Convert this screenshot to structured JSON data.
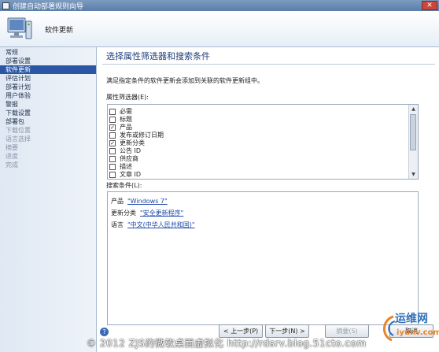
{
  "window": {
    "title": "创建自动部署规则向导",
    "close_glyph": "✕"
  },
  "header": {
    "title": "软件更新"
  },
  "sidebar": {
    "items": [
      {
        "label": "常规",
        "state": "normal"
      },
      {
        "label": "部署设置",
        "state": "normal"
      },
      {
        "label": "软件更新",
        "state": "active"
      },
      {
        "label": "评估计划",
        "state": "normal"
      },
      {
        "label": "部署计划",
        "state": "normal"
      },
      {
        "label": "用户体验",
        "state": "normal"
      },
      {
        "label": "警报",
        "state": "normal"
      },
      {
        "label": "下载设置",
        "state": "normal"
      },
      {
        "label": "部署包",
        "state": "normal"
      },
      {
        "label": "下载位置",
        "state": "disabled"
      },
      {
        "label": "语言选择",
        "state": "disabled"
      },
      {
        "label": "摘要",
        "state": "disabled"
      },
      {
        "label": "进度",
        "state": "disabled"
      },
      {
        "label": "完成",
        "state": "disabled"
      }
    ]
  },
  "main": {
    "page_title": "选择属性筛选器和搜索条件",
    "description": "满足指定条件的软件更新会添加到关联的软件更新组中。",
    "filter_label": "属性筛选器(E):",
    "filters": [
      {
        "label": "必需",
        "checked": false
      },
      {
        "label": "标题",
        "checked": false
      },
      {
        "label": "产品",
        "checked": true
      },
      {
        "label": "发布或修订日期",
        "checked": false
      },
      {
        "label": "更新分类",
        "checked": true
      },
      {
        "label": "公告 ID",
        "checked": false
      },
      {
        "label": "供应商",
        "checked": false
      },
      {
        "label": "描述",
        "checked": false
      },
      {
        "label": "文章 ID",
        "checked": false
      }
    ],
    "criteria_label": "搜索条件(L):",
    "criteria": [
      {
        "label": "产品",
        "value": "\"Windows 7\""
      },
      {
        "label": "更新分类",
        "value": "\"安全更新程序\""
      },
      {
        "label": "语言",
        "value": "\"中文(中华人民共和国)\""
      }
    ]
  },
  "buttons": {
    "help": "?",
    "back": "< 上一步(P)",
    "next": "下一步(N) >",
    "summary": "摘要(S)",
    "cancel": "取消"
  },
  "watermark": "© 2012 ZJS的微软桌面虚拟化 http://rdsrv.blog.51cto.com",
  "logo": {
    "text": "运维网",
    "subtext": "iyunv.com"
  }
}
